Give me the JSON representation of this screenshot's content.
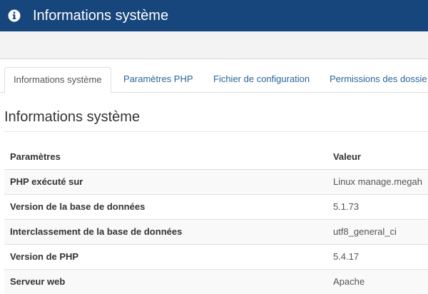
{
  "header": {
    "icon": "info-circle-icon",
    "title": "Informations système",
    "background_color": "#17467c"
  },
  "tabs": [
    {
      "label": "Informations système",
      "active": true
    },
    {
      "label": "Paramètres PHP",
      "active": false
    },
    {
      "label": "Fichier de configuration",
      "active": false
    },
    {
      "label": "Permissions des dossie",
      "active": false
    }
  ],
  "section": {
    "title": "Informations système"
  },
  "table": {
    "columns": [
      "Paramètres",
      "Valeur"
    ],
    "rows": [
      {
        "param": "PHP exécuté sur",
        "value": "Linux manage.megah"
      },
      {
        "param": "Version de la base de données",
        "value": "5.1.73"
      },
      {
        "param": "Interclassement de la base de données",
        "value": "utf8_general_ci"
      },
      {
        "param": "Version de PHP",
        "value": "5.4.17"
      },
      {
        "param": "Serveur web",
        "value": "Apache"
      }
    ]
  },
  "colors": {
    "link": "#2a6496",
    "accent": "#17467c"
  }
}
